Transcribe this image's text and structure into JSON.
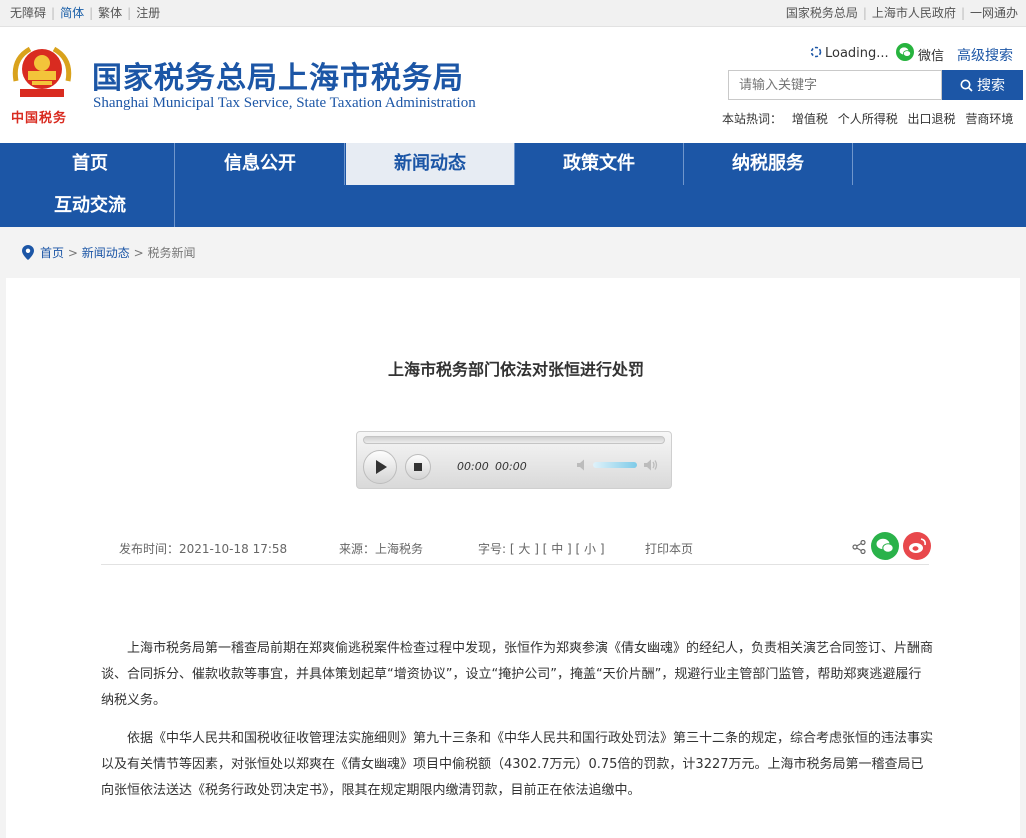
{
  "topbar": {
    "left_links": [
      {
        "label": "无障碍"
      },
      {
        "label": "简体"
      },
      {
        "label": "繁体"
      },
      {
        "label": "注册"
      }
    ],
    "right_links": [
      {
        "label": "国家税务总局"
      },
      {
        "label": "上海市人民政府"
      },
      {
        "label": "一网通办"
      }
    ]
  },
  "header": {
    "emblem_text": "中国税务",
    "title_cn": "国家税务总局上海市税务局",
    "title_en": "Shanghai Municipal Tax Service, State Taxation Administration",
    "loading_label": "Loading...",
    "wechat_label": "微信",
    "advanced_search_label": "高级搜索",
    "search": {
      "placeholder": "请输入关键字",
      "button_label": "搜索"
    },
    "hotwords_label": "本站热词：",
    "hotwords": [
      "增值税",
      "个人所得税",
      "出口退税",
      "营商环境"
    ]
  },
  "nav": {
    "items": [
      {
        "label": "首页"
      },
      {
        "label": "信息公开"
      },
      {
        "label": "新闻动态",
        "active": true
      },
      {
        "label": "政策文件"
      },
      {
        "label": "纳税服务"
      },
      {
        "label": "互动交流"
      }
    ]
  },
  "breadcrumb": {
    "items": [
      "首页",
      "新闻动态",
      "税务新闻"
    ],
    "separator": ">"
  },
  "article": {
    "title": "上海市税务部门依法对张恒进行处罚",
    "audio": {
      "current_time": "00:00",
      "duration": "00:00",
      "progress": 0,
      "volume": 0.8
    },
    "meta": {
      "publish_label": "发布时间：",
      "publish_time": "2021-10-18 17:58",
      "source": "来源：上海税务",
      "font_label": "字号:",
      "font_large": "大",
      "font_medium": "中",
      "font_small": "小",
      "print_label": "打印本页"
    },
    "paragraphs": [
      "上海市税务局第一稽查局前期在郑爽偷逃税案件检查过程中发现，张恒作为郑爽参演《倩女幽魂》的经纪人，负责相关演艺合同签订、片酬商谈、合同拆分、催款收款等事宜，并具体策划起草“增资协议”，设立“掩护公司”，掩盖“天价片酬”，规避行业主管部门监管，帮助郑爽逃避履行纳税义务。",
      "依据《中华人民共和国税收征收管理法实施细则》第九十三条和《中华人民共和国行政处罚法》第三十二条的规定，综合考虑张恒的违法事实以及有关情节等因素，对张恒处以郑爽在《倩女幽魂》项目中偷税额（4302.7万元）0.75倍的罚款，计3227万元。上海市税务局第一稽查局已向张恒依法送达《税务行政处罚决定书》，限其在规定期限内缴清罚款，目前正在依法追缴中。"
    ]
  },
  "colors": {
    "brand": "#1c56a6",
    "wechat": "#2ab24a",
    "weibo": "#e8484c"
  }
}
